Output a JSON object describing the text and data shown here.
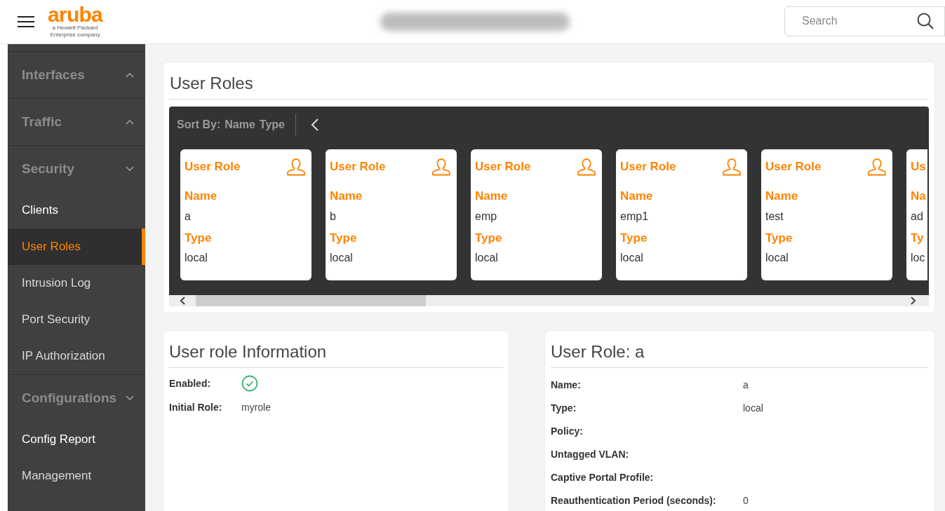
{
  "header": {
    "brand": "aruba",
    "brand_tagline": "a Hewlett Packard Enterprise company",
    "search": {
      "placeholder": "Search"
    }
  },
  "sidebar": {
    "sections": [
      {
        "label": "Interfaces",
        "expanded": false
      },
      {
        "label": "Traffic",
        "expanded": false
      },
      {
        "label": "Security",
        "expanded": true,
        "children": [
          {
            "label": "Clients",
            "selected": false
          },
          {
            "label": "User Roles",
            "selected": true
          },
          {
            "label": "Intrusion Log",
            "selected": false
          },
          {
            "label": "Port Security",
            "selected": false
          },
          {
            "label": "IP Authorization",
            "selected": false
          }
        ]
      },
      {
        "label": "Configurations",
        "expanded": true,
        "children": [
          {
            "label": "Config Report",
            "selected": false
          },
          {
            "label": "Management",
            "selected": false
          }
        ]
      }
    ]
  },
  "roles_panel": {
    "title": "User Roles",
    "sort_label": "Sort By:",
    "sort_options": [
      "Name",
      "Type"
    ],
    "cards": [
      {
        "title": "User Role",
        "name_label": "Name",
        "name": "a",
        "type_label": "Type",
        "type": "local",
        "partial": false
      },
      {
        "title": "User Role",
        "name_label": "Name",
        "name": "b",
        "type_label": "Type",
        "type": "local",
        "partial": false
      },
      {
        "title": "User Role",
        "name_label": "Name",
        "name": "emp",
        "type_label": "Type",
        "type": "local",
        "partial": false
      },
      {
        "title": "User Role",
        "name_label": "Name",
        "name": "emp1",
        "type_label": "Type",
        "type": "local",
        "partial": false
      },
      {
        "title": "User Role",
        "name_label": "Name",
        "name": "test",
        "type_label": "Type",
        "type": "local",
        "partial": false
      },
      {
        "title": "Us",
        "name_label": "Na",
        "name": "ad",
        "type_label": "Ty",
        "type": "loc",
        "partial": true
      }
    ]
  },
  "info_panel": {
    "title": "User role Information",
    "rows": [
      {
        "label": "Enabled:",
        "kind": "check",
        "checked": true
      },
      {
        "label": "Initial Role:",
        "kind": "text",
        "value": "myrole"
      }
    ]
  },
  "detail_panel": {
    "title": "User Role: a",
    "rows": [
      {
        "label": "Name:",
        "value": "a"
      },
      {
        "label": "Type:",
        "value": "local"
      },
      {
        "label": "Policy:"
      },
      {
        "label": "Untagged VLAN:"
      },
      {
        "label": "Captive Portal Profile:"
      },
      {
        "label": "Reauthentication Period (seconds):",
        "value": "0"
      }
    ]
  }
}
